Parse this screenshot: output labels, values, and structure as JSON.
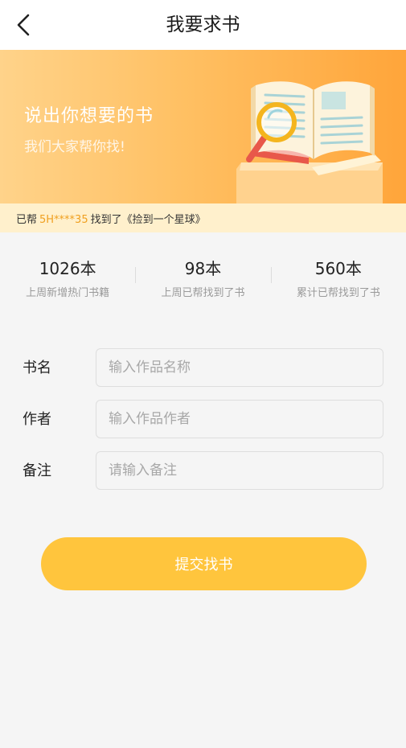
{
  "header": {
    "title": "我要求书",
    "back_icon": "chevron-left-icon"
  },
  "banner": {
    "title": "说出你想要的书",
    "subtitle": "我们大家帮你找!",
    "illustration_icon": "open-book-magnifier-illustration"
  },
  "ticker": {
    "prefix": "已帮",
    "user": "5H****35",
    "text": "找到了《捡到一个星球》"
  },
  "stats": [
    {
      "value": "1026本",
      "label": "上周新增热门书籍"
    },
    {
      "value": "98本",
      "label": "上周已帮找到了书"
    },
    {
      "value": "560本",
      "label": "累计已帮找到了书"
    }
  ],
  "form": {
    "fields": [
      {
        "label": "书名",
        "placeholder": "输入作品名称",
        "value": ""
      },
      {
        "label": "作者",
        "placeholder": "输入作品作者",
        "value": ""
      },
      {
        "label": "备注",
        "placeholder": "请输入备注",
        "value": ""
      }
    ],
    "submit_label": "提交找书"
  },
  "colors": {
    "accent": "#ffc53d",
    "banner_start": "#ffd38a",
    "banner_end": "#ffa53a",
    "ticker_bg": "#fff0cc",
    "ticker_user": "#f0a020",
    "background": "#f5f5f5"
  }
}
